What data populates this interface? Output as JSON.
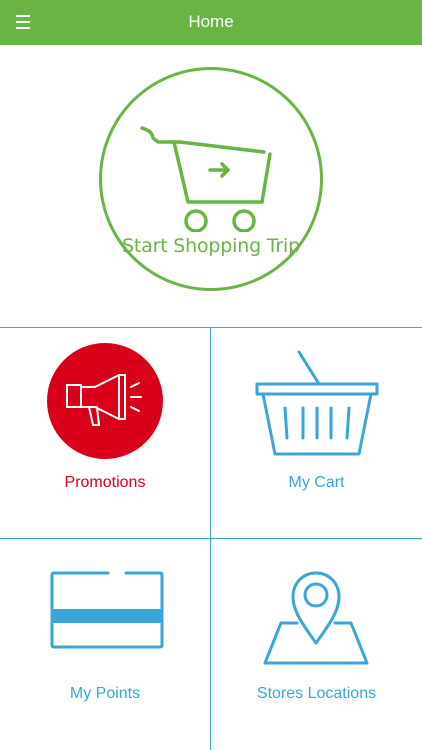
{
  "header": {
    "title": "Home",
    "menu_icon": "hamburger-menu-icon"
  },
  "hero": {
    "start_label": "Start Shopping Trip",
    "icon": "shopping-cart-arrow-icon"
  },
  "tiles": [
    {
      "label": "Promotions",
      "icon": "megaphone-icon",
      "color": "#d9001a"
    },
    {
      "label": "My Cart",
      "icon": "basket-icon",
      "color": "#3aa6d8"
    },
    {
      "label": "My Points",
      "icon": "card-icon",
      "color": "#3aa6d8"
    },
    {
      "label": "Stores Locations",
      "icon": "map-pin-icon",
      "color": "#3aa6d8"
    }
  ],
  "colors": {
    "header_bg": "#6ab446",
    "accent_green": "#6ab446",
    "accent_blue": "#3aa6d8",
    "accent_red": "#d9001a"
  }
}
